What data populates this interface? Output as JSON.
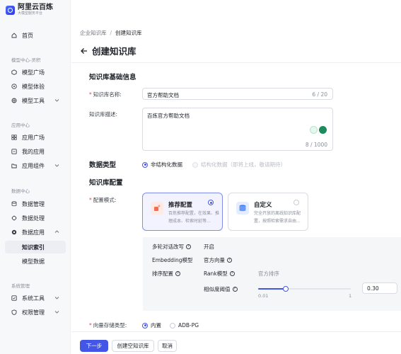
{
  "brand": {
    "title": "阿里云百炼",
    "subtitle": "大模型服务平台"
  },
  "sidebar": {
    "home": "首页",
    "groups": [
      {
        "label": "模型中心-灵积"
      },
      {
        "label": "应用中心"
      },
      {
        "label": "数据中心"
      },
      {
        "label": "系统管理"
      }
    ],
    "items": [
      {
        "label": "模型广场",
        "icon": "cube-icon"
      },
      {
        "label": "模型体验",
        "icon": "chat-icon"
      },
      {
        "label": "模型工具",
        "icon": "tool-icon"
      },
      {
        "label": "应用广场",
        "icon": "grid-icon"
      },
      {
        "label": "我的应用",
        "icon": "app-icon"
      },
      {
        "label": "应用组件",
        "icon": "folder-icon"
      },
      {
        "label": "数据管理",
        "icon": "database-icon"
      },
      {
        "label": "数据处理",
        "icon": "process-icon"
      },
      {
        "label": "数据应用",
        "icon": "data-app-icon"
      },
      {
        "label": "知识索引",
        "icon": ""
      },
      {
        "label": "模型数据",
        "icon": ""
      },
      {
        "label": "系统工具",
        "icon": "settings-icon"
      },
      {
        "label": "权限管理",
        "icon": "shield-icon"
      }
    ]
  },
  "breadcrumb": {
    "parent": "企业知识库",
    "separator": "/",
    "current": "创建知识库"
  },
  "page_title": "创建知识库",
  "basic": {
    "section_title": "知识库基础信息",
    "name_label": "知识库名称:",
    "name_value": "官方帮助文档",
    "name_count": "6 / 20",
    "desc_label": "知识库描述:",
    "desc_value": "百炼官方帮助文档",
    "desc_count": "8 / 1000"
  },
  "data_type": {
    "section_title": "数据类型",
    "option1": "非结构化数据",
    "option2": "结构化数据（即将上线，敬请期待）"
  },
  "config": {
    "section_title": "知识库配置",
    "mode_label": "配置模式:",
    "card1": {
      "title": "推荐配置",
      "desc": "百炼推荐配置，在效果、推理成本、检索时延等..."
    },
    "card2": {
      "title": "自定义",
      "desc": "完全开放的离线知识库配置，按照检索需求自由..."
    },
    "rows": {
      "multi_turn_label": "多轮对话改写",
      "multi_turn_value": "开启",
      "embedding_label": "Embedding模型",
      "embedding_value": "官方向量",
      "rank_label": "排序配置",
      "rank_model_label": "Rank模型",
      "rank_model_value": "官方排序",
      "threshold_label": "相似度阈值",
      "threshold_value": "0.30",
      "slider_min": "0.01",
      "slider_max": "1",
      "slider_position": 0.3
    },
    "vector_label": "向量存储类型:",
    "vector_opt1": "内置",
    "vector_opt2": "ADB-PG"
  },
  "footer": {
    "next": "下一步",
    "create_empty": "创建空知识库",
    "cancel": "取消"
  },
  "colors": {
    "accent": "#4456e6",
    "sidebar_bg": "#f7f8fa",
    "panel_bg": "#f5f6f8"
  }
}
